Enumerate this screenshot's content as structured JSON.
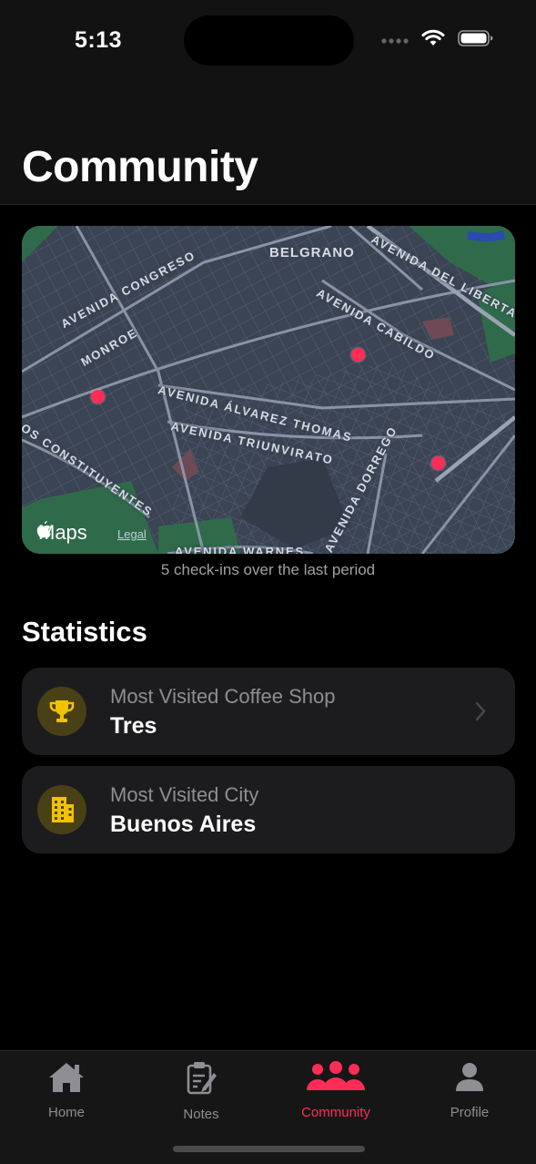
{
  "status_bar": {
    "time": "5:13"
  },
  "header": {
    "title": "Community"
  },
  "map": {
    "street_labels": [
      "BELGRANO",
      "AVENIDA DEL LIBERTADOR",
      "AVENIDA CONGRESO",
      "AVENIDA CABILDO",
      "MONROE",
      "AVENIDA ÁLVAREZ THOMAS",
      "AVENIDA TRIUNVIRATO",
      "DE LOS CONSTITUYENTES",
      "AVENIDA DORREGO",
      "AVENIDA WARNES"
    ],
    "logo_text": "Maps",
    "legal_text": "Legal",
    "pin_color": "#ff2d55"
  },
  "caption": "5 check-ins over the last period",
  "statistics": {
    "title": "Statistics",
    "cards": [
      {
        "label": "Most Visited Coffee Shop",
        "value": "Tres",
        "icon": "trophy-icon"
      },
      {
        "label": "Most Visited City",
        "value": "Buenos Aires",
        "icon": "building-icon"
      }
    ]
  },
  "tabs": [
    {
      "label": "Home",
      "icon": "house-icon",
      "active": false
    },
    {
      "label": "Notes",
      "icon": "notes-icon",
      "active": false
    },
    {
      "label": "Community",
      "icon": "people-icon",
      "active": true
    },
    {
      "label": "Profile",
      "icon": "person-icon",
      "active": false
    }
  ],
  "colors": {
    "accent": "#ff2d55",
    "icon_yellow": "#f2c200",
    "card_bg": "#1c1c1e"
  }
}
